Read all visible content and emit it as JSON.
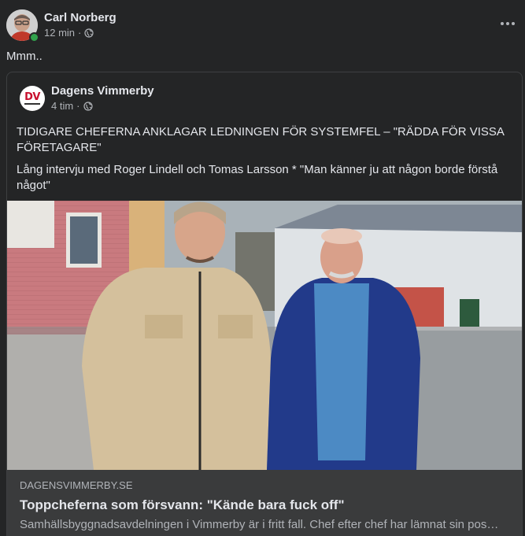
{
  "post": {
    "author": "Carl Norberg",
    "time": "12 min",
    "separator": "·",
    "audience_icon": "globe-icon",
    "text": "Mmm..",
    "more_icon": "more-options-icon"
  },
  "shared": {
    "page_logo_text": "DV",
    "page_name": "Dagens Vimmerby",
    "time": "4 tim",
    "separator": "·",
    "headline": "TIDIGARE CHEFERNA ANKLAGAR LEDNINGEN FÖR SYSTEMFEL – \"RÄDDA FÖR VISSA FÖRETAGARE\"",
    "body": "Lång intervju med Roger Lindell och Tomas Larsson * \"Man känner ju att någon borde förstå något\""
  },
  "link_preview": {
    "domain": "DAGENSVIMMERBY.SE",
    "title": "Toppcheferna som försvann: \"Kände bara fuck off\"",
    "description": "Samhällsbyggnadsavdelningen i Vimmerby är i fritt fall. Chef efter chef har lämnat sin pos…"
  },
  "colors": {
    "background": "#242526",
    "preview_bg": "#3a3b3c",
    "text_primary": "#e4e6eb",
    "text_secondary": "#b0b3b8",
    "online": "#31a24c",
    "dv_red": "#c8102e"
  }
}
